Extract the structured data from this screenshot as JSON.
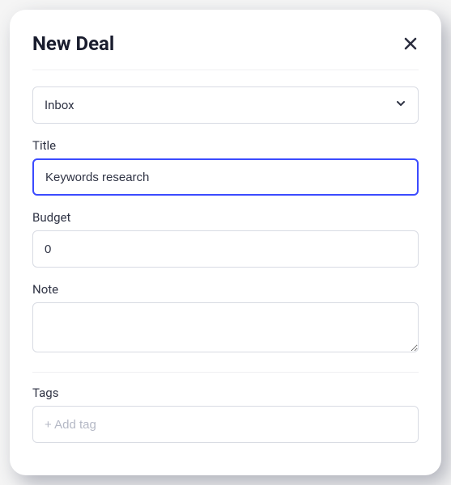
{
  "modal": {
    "title": "New Deal"
  },
  "pipeline": {
    "selected": "Inbox"
  },
  "fields": {
    "title": {
      "label": "Title",
      "value": "Keywords research"
    },
    "budget": {
      "label": "Budget",
      "value": "0"
    },
    "note": {
      "label": "Note",
      "value": ""
    },
    "tags": {
      "label": "Tags",
      "placeholder": "+ Add tag",
      "value": ""
    }
  }
}
